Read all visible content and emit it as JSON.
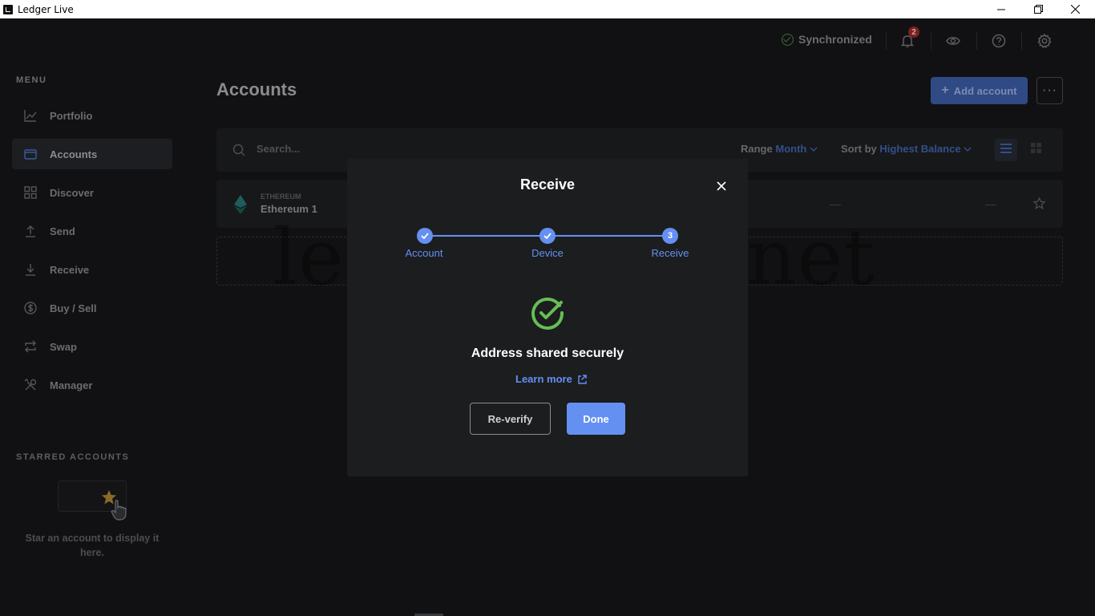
{
  "window": {
    "title": "Ledger Live",
    "icons": [
      "minimize-icon",
      "restore-icon",
      "close-icon"
    ]
  },
  "sidebar": {
    "menu_title": "MENU",
    "items": [
      {
        "label": "Portfolio",
        "icon": "chart-icon",
        "active": false
      },
      {
        "label": "Accounts",
        "icon": "wallet-icon",
        "active": true
      },
      {
        "label": "Discover",
        "icon": "grid-icon",
        "active": false
      },
      {
        "label": "Send",
        "icon": "upload-icon",
        "active": false
      },
      {
        "label": "Receive",
        "icon": "download-icon",
        "active": false
      },
      {
        "label": "Buy / Sell",
        "icon": "dollar-icon",
        "active": false
      },
      {
        "label": "Swap",
        "icon": "swap-icon",
        "active": false
      },
      {
        "label": "Manager",
        "icon": "tools-icon",
        "active": false
      }
    ],
    "starred_title": "STARRED ACCOUNTS",
    "starred_empty_text": "Star an account to display it here."
  },
  "topbar": {
    "sync_status": "Synchronized",
    "notification_count": "2",
    "icons": [
      "bell-icon",
      "eye-icon",
      "help-icon",
      "gear-icon"
    ]
  },
  "main": {
    "page_title": "Accounts",
    "add_account_label": "Add account",
    "more_label": "···",
    "search_placeholder": "Search...",
    "range_label": "Range",
    "range_value": "Month",
    "sort_label": "Sort by",
    "sort_value": "Highest Balance",
    "accounts": [
      {
        "currency": "ETHEREUM",
        "name": "Ethereum 1",
        "dash1": "—",
        "dash2": "—"
      }
    ]
  },
  "watermark": "ledgernano.net",
  "modal": {
    "title": "Receive",
    "steps": [
      {
        "label": "Account",
        "state": "done"
      },
      {
        "label": "Device",
        "state": "done"
      },
      {
        "label": "Receive",
        "state": "current",
        "number": "3"
      }
    ],
    "success_text": "Address shared securely",
    "learn_more_label": "Learn more",
    "reverify_label": "Re-verify",
    "done_label": "Done"
  },
  "colors": {
    "accent": "#6490f1",
    "success": "#66be54",
    "sidebar_bg": "#111113",
    "modal_bg": "#1c1d1f"
  }
}
